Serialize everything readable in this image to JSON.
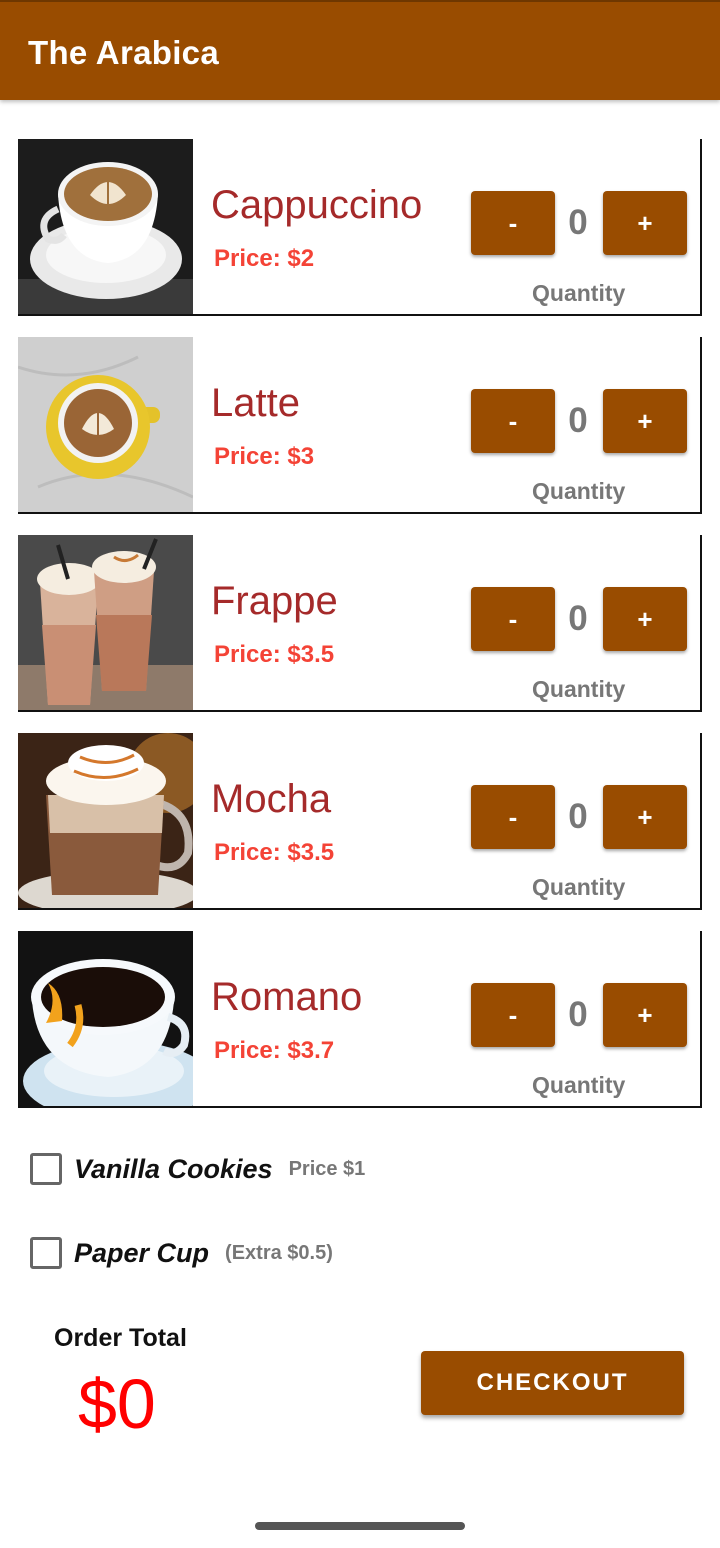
{
  "app_bar": {
    "title": "The Arabica"
  },
  "colors": {
    "primary": "#994C00",
    "name": "#a52a2a",
    "price": "#f44336",
    "total": "#ff0000"
  },
  "products": [
    {
      "name": "Cappuccino",
      "price": "Price: $2",
      "quantity": "0",
      "minus": "-",
      "plus": "+",
      "quantity_label": "Quantity",
      "image": "cappuccino-photo"
    },
    {
      "name": "Latte",
      "price": "Price: $3",
      "quantity": "0",
      "minus": "-",
      "plus": "+",
      "quantity_label": "Quantity",
      "image": "latte-photo"
    },
    {
      "name": "Frappe",
      "price": "Price: $3.5",
      "quantity": "0",
      "minus": "-",
      "plus": "+",
      "quantity_label": "Quantity",
      "image": "frappe-photo"
    },
    {
      "name": "Mocha",
      "price": "Price: $3.5",
      "quantity": "0",
      "minus": "-",
      "plus": "+",
      "quantity_label": "Quantity",
      "image": "mocha-photo"
    },
    {
      "name": "Romano",
      "price": "Price: $3.7",
      "quantity": "0",
      "minus": "-",
      "plus": "+",
      "quantity_label": "Quantity",
      "image": "romano-photo"
    }
  ],
  "extras": [
    {
      "name": "Vanilla Cookies",
      "price": "Price $1",
      "checked": false
    },
    {
      "name": "Paper Cup",
      "price": "(Extra $0.5)",
      "checked": false
    }
  ],
  "order": {
    "total_label": "Order Total",
    "total_value": "$0",
    "checkout_label": "CHECKOUT"
  }
}
